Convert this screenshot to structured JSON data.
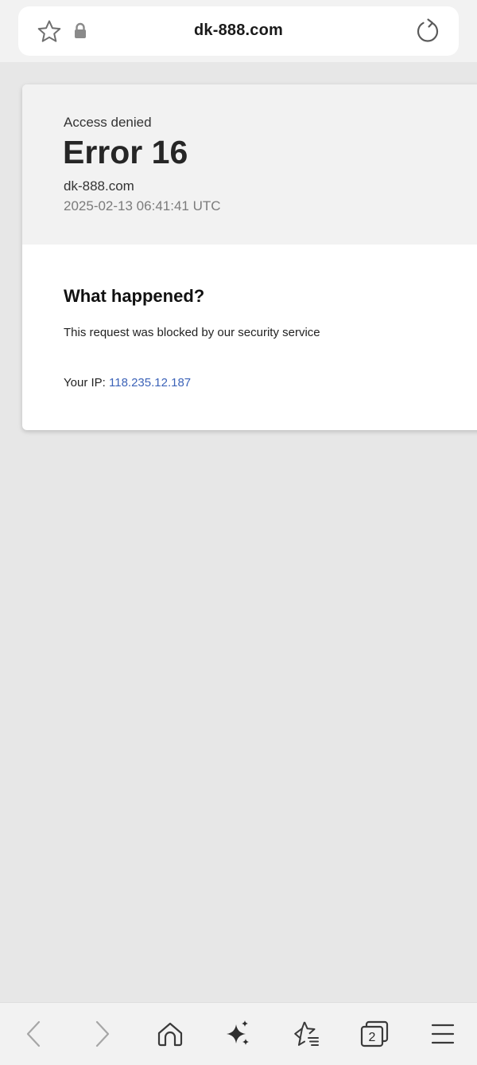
{
  "browser": {
    "url": "dk-888.com",
    "tab_count": "2"
  },
  "error_page": {
    "status": "Access denied",
    "title": "Error 16",
    "site": "dk-888.com",
    "timestamp": "2025-02-13 06:41:41 UTC",
    "section_heading": "What happened?",
    "message": "This request was blocked by our security service",
    "ip_label": "Your IP:",
    "ip_value": "118.235.12.187"
  },
  "colors": {
    "page_background": "#e7e7e7",
    "card_header": "#f2f2f2",
    "link_blue": "#3c63b8"
  },
  "icons": {
    "top_bar": [
      "star-icon",
      "lock-icon",
      "reload-icon"
    ],
    "bottom_bar": [
      "back-icon",
      "forward-icon",
      "home-icon",
      "sparkle-icon",
      "bookmarks-icon",
      "tabs-icon",
      "menu-icon"
    ]
  }
}
